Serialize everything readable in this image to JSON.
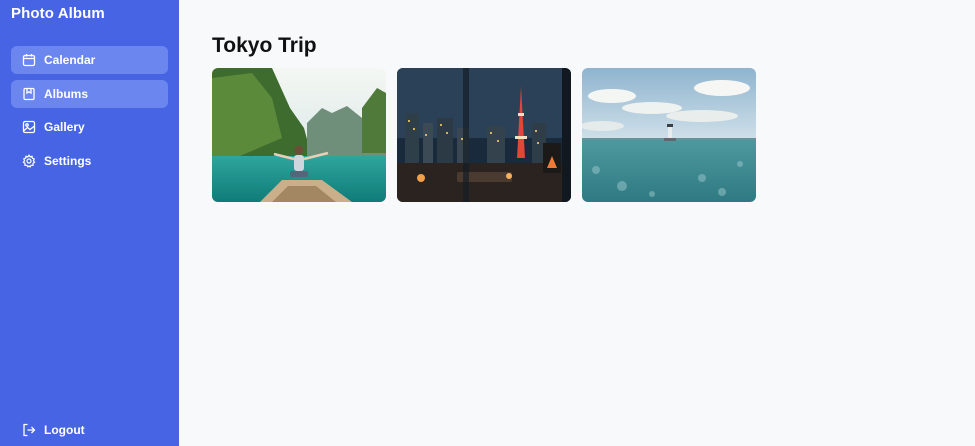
{
  "app": {
    "title": "Photo Album"
  },
  "sidebar": {
    "items": [
      {
        "label": "Calendar",
        "icon": "calendar-icon",
        "highlighted": true
      },
      {
        "label": "Albums",
        "icon": "album-icon",
        "highlighted": true
      },
      {
        "label": "Gallery",
        "icon": "image-icon",
        "highlighted": false
      },
      {
        "label": "Settings",
        "icon": "gear-icon",
        "highlighted": false
      }
    ],
    "logout_label": "Logout",
    "logout_icon": "logout-icon"
  },
  "album": {
    "title": "Tokyo Trip",
    "photos": [
      {
        "name": "photo-boat-lagoon"
      },
      {
        "name": "photo-tokyo-tower-night"
      },
      {
        "name": "photo-sea-lighthouse"
      }
    ]
  },
  "colors": {
    "sidebar": "#4664e3",
    "nav_highlight": "#6b87ef",
    "background": "#f8f9fb"
  }
}
